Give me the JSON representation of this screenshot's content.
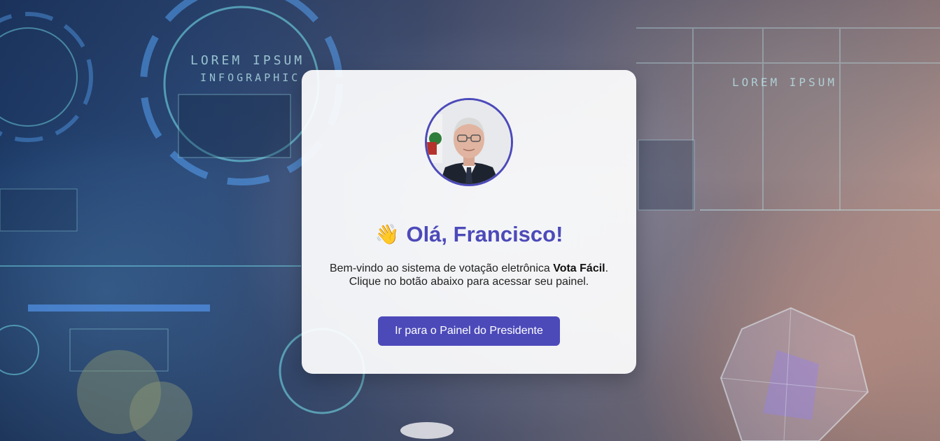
{
  "background": {
    "hud_title": "LOREM IPSUM",
    "hud_subtitle": "INFOGRAPHIC",
    "hud_title_right": "LOREM IPSUM"
  },
  "card": {
    "avatar_alt": "Foto do Presidente",
    "greeting_icon": "waving-hand-icon",
    "greeting_emoji": "👋",
    "greeting": "Olá, Francisco!",
    "welcome_line1_prefix": "Bem-vindo ao sistema de votação eletrônica ",
    "brand_name": "Vota Fácil",
    "welcome_line1_suffix": ".",
    "welcome_line2": "Clique no botão abaixo para acessar seu painel.",
    "button_label": "Ir para o Painel do Presidente"
  },
  "colors": {
    "accent": "#4c4ab9",
    "card_background": "#ffffff",
    "button_text": "#ffffff"
  }
}
